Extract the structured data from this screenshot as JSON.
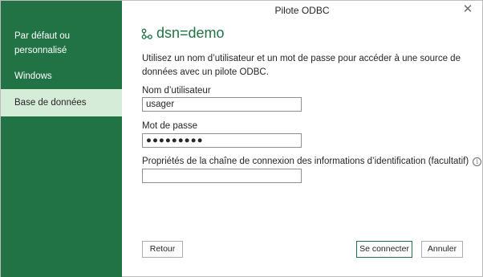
{
  "dialog": {
    "title": "Pilote ODBC",
    "close_label": "✕"
  },
  "sidebar": {
    "items": [
      {
        "label_line1": "Par défaut ou",
        "label_line2": "personnalisé"
      },
      {
        "label": "Windows"
      },
      {
        "label": "Base de données",
        "selected": true
      }
    ]
  },
  "main": {
    "heading": "dsn=demo",
    "heading_icon": "connection-icon",
    "description": "Utilisez un nom d’utilisateur et un mot de passe pour accéder à une source de données avec un pilote ODBC.",
    "username": {
      "label": "Nom d’utilisateur",
      "value": "usager"
    },
    "password": {
      "label": "Mot de passe",
      "value": "●●●●●●●●●"
    },
    "connection_props": {
      "label": "Propriétés de la chaîne de connexion des informations d’identification (facultatif)",
      "value": "",
      "info_icon": "i"
    }
  },
  "buttons": {
    "back": "Retour",
    "connect": "Se connecter",
    "cancel": "Annuler"
  },
  "colors": {
    "accent": "#217346",
    "selected_bg": "#d5ecd9"
  }
}
